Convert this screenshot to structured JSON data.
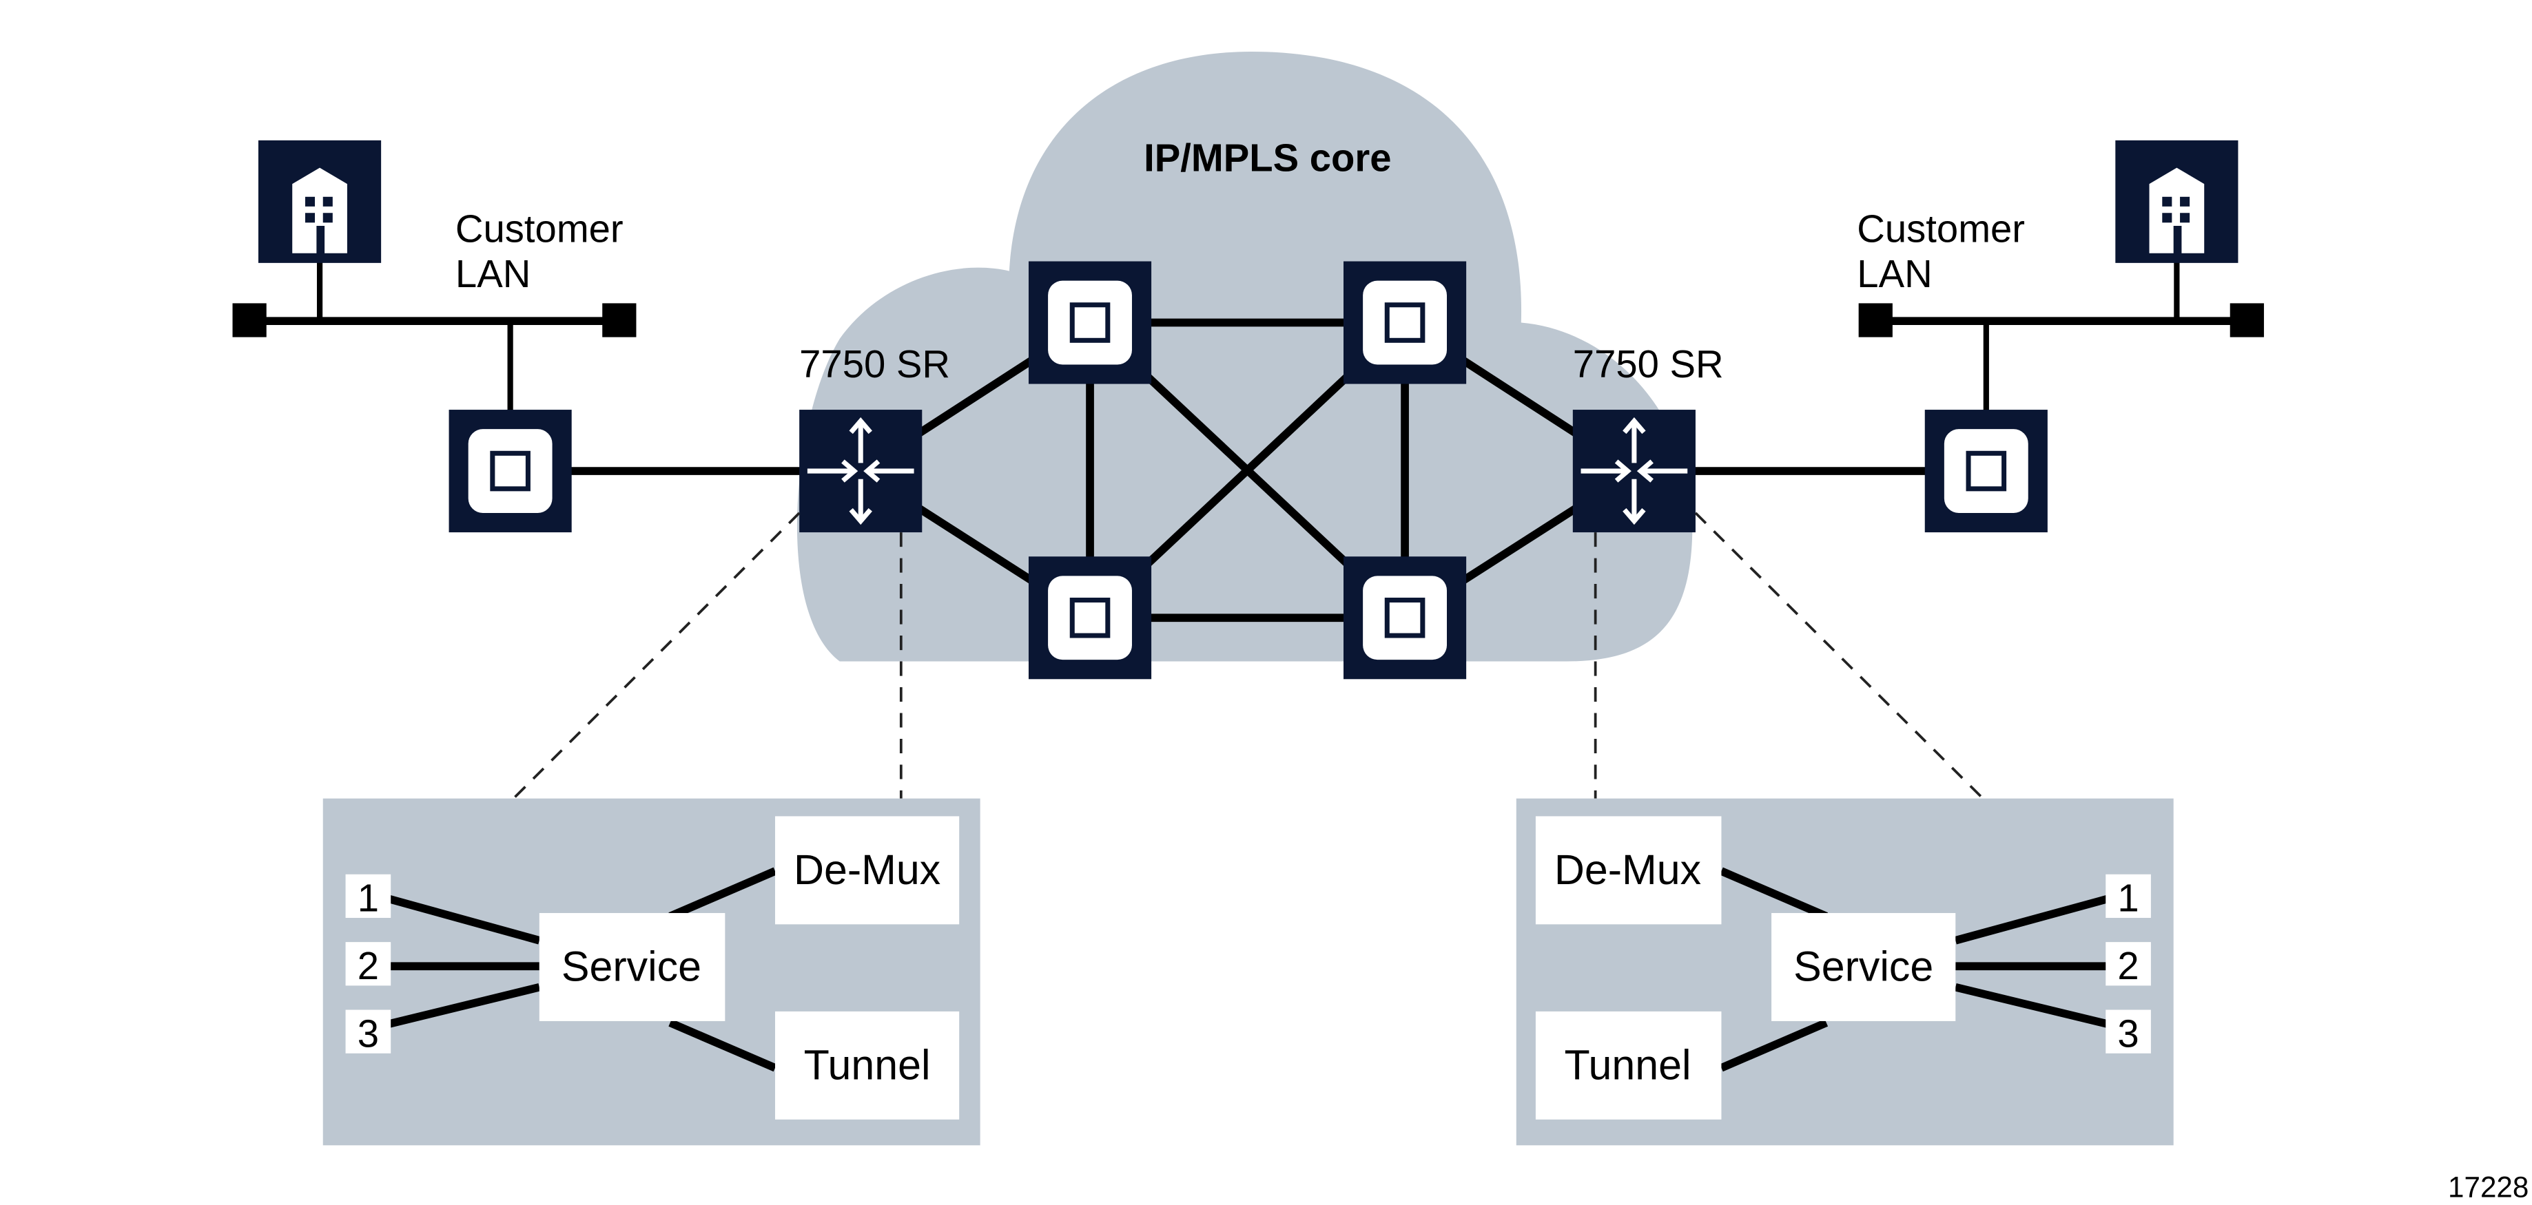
{
  "figure_id": "17228",
  "colors": {
    "node": "#0a1633",
    "cloud": "#bdc7d1",
    "panel": "#bdc7d1",
    "link": "#000000"
  },
  "core": {
    "label": "IP/MPLS core"
  },
  "left_site": {
    "lan_label_line1": "Customer",
    "lan_label_line2": "LAN",
    "router_label": "7750 SR"
  },
  "right_site": {
    "lan_label_line1": "Customer",
    "lan_label_line2": "LAN",
    "router_label": "7750 SR"
  },
  "left_panel": {
    "ports": [
      "1",
      "2",
      "3"
    ],
    "service": "Service",
    "demux": "De-Mux",
    "tunnel": "Tunnel"
  },
  "right_panel": {
    "ports": [
      "1",
      "2",
      "3"
    ],
    "service": "Service",
    "demux": "De-Mux",
    "tunnel": "Tunnel"
  }
}
